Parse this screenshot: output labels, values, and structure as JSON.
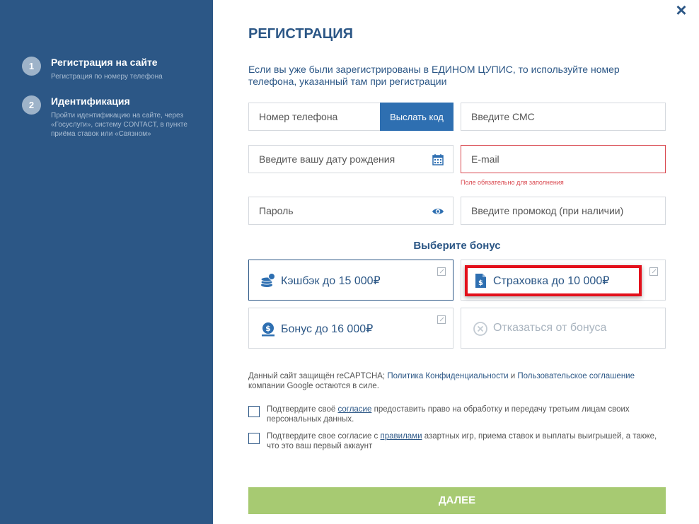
{
  "sidebar": {
    "steps": [
      {
        "number": "1",
        "title": "Регистрация на сайте",
        "desc": "Регистрация по номеру телефона"
      },
      {
        "number": "2",
        "title": "Идентификация",
        "desc": "Пройти идентификацию на сайте, через «Госуслуги», систему CONTACT, в пункте приёма ставок или «Связном»"
      }
    ]
  },
  "header": {
    "close_icon": "×",
    "title": "РЕГИСТРАЦИЯ",
    "intro": "Если вы уже были зарегистрированы в ЕДИНОМ ЦУПИС, то используйте номер телефона, указанный там при регистрации"
  },
  "form": {
    "phone_placeholder": "Номер телефона",
    "send_code_label": "Выслать код",
    "sms_placeholder": "Введите СМС",
    "birthdate_placeholder": "Введите вашу дату рождения",
    "email_placeholder": "E-mail",
    "email_error": "Поле обязательно для заполнения",
    "password_placeholder": "Пароль",
    "promo_placeholder": "Введите промокод (при наличии)"
  },
  "bonus": {
    "heading": "Выберите бонус",
    "options": [
      {
        "label": "Кэшбэк до 15 000₽",
        "icon": "coins-icon",
        "selected": true
      },
      {
        "label": "Страховка до 10 000₽",
        "icon": "insurance-document-icon",
        "selected": false
      },
      {
        "label": "Бонус до 16 000₽",
        "icon": "money-bag-icon",
        "selected": false
      },
      {
        "label": "Отказаться от бонуса",
        "icon": "decline-icon",
        "selected": false
      }
    ]
  },
  "captcha": {
    "prefix": "Данный сайт защищён reCAPTCHA; ",
    "privacy_link": "Политика Конфиденциальности",
    "and": " и ",
    "terms_link": "Пользовательское соглашение",
    "suffix": " компании Google остаются в силе."
  },
  "consents": [
    {
      "before": "Подтвердите своё ",
      "link": "согласие",
      "after": " предоставить право на обработку и передачу третьим лицам своих персональных данных."
    },
    {
      "before": "Подтвердите свое согласие с ",
      "link": "правилами",
      "after": " азартных игр, приема ставок и выплаты выигрышей, а также, что это ваш первый аккаунт"
    }
  ],
  "submit_label": "ДАЛЕЕ",
  "colors": {
    "sidebar": "#2c5786",
    "accent": "#2e6fb1",
    "error": "#d9484f",
    "submit": "#a7ca72",
    "highlight": "#e3101b"
  }
}
